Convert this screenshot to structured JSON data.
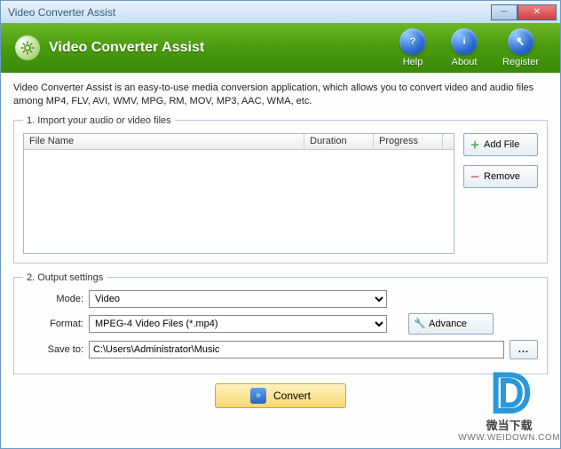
{
  "window": {
    "title": "Video Converter Assist"
  },
  "header": {
    "app_title": "Video Converter Assist",
    "help": "Help",
    "about": "About",
    "register": "Register"
  },
  "description": "Video Converter Assist is an easy-to-use media conversion application, which allows you to convert video and audio files among MP4, FLV, AVI, WMV, MPG, RM, MOV, MP3, AAC, WMA, etc.",
  "section1": {
    "legend": "1. Import your audio or video files",
    "cols": {
      "filename": "File Name",
      "duration": "Duration",
      "progress": "Progress"
    },
    "files": [],
    "add_file": "Add File",
    "remove": "Remove"
  },
  "section2": {
    "legend": "2. Output settings",
    "mode_label": "Mode:",
    "mode_value": "Video",
    "format_label": "Format:",
    "format_value": "MPEG-4 Video Files (*.mp4)",
    "saveto_label": "Save to:",
    "saveto_value": "C:\\Users\\Administrator\\Music",
    "advance": "Advance",
    "browse": "..."
  },
  "convert": "Convert",
  "watermark": {
    "cn": "微当下载",
    "url": "WWW.WEIDOWN.COM"
  }
}
